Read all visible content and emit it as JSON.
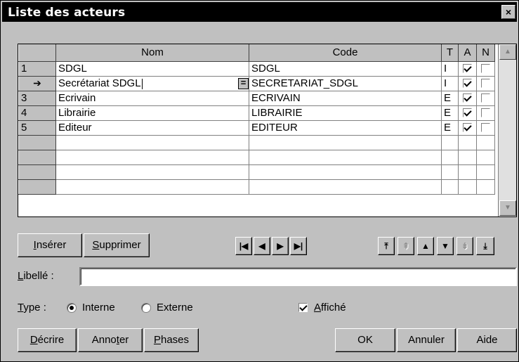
{
  "window": {
    "title": "Liste des acteurs",
    "close_label": "×"
  },
  "grid": {
    "columns": {
      "nom": "Nom",
      "code": "Code",
      "t": "T",
      "a": "A",
      "n": "N"
    },
    "rows": [
      {
        "marker": "1",
        "nom": "SDGL",
        "code": "SDGL",
        "t": "I",
        "a": true,
        "n": false
      },
      {
        "marker": "➔",
        "nom": "Secrétariat SDGL",
        "code": "SECRETARIAT_SDGL",
        "t": "I",
        "a": true,
        "n": false,
        "edit_button": "="
      },
      {
        "marker": "3",
        "nom": "Ecrivain",
        "code": "ECRIVAIN",
        "t": "E",
        "a": true,
        "n": false
      },
      {
        "marker": "4",
        "nom": "Librairie",
        "code": "LIBRAIRIE",
        "t": "E",
        "a": true,
        "n": false
      },
      {
        "marker": "5",
        "nom": "Editeur",
        "code": "EDITEUR",
        "t": "E",
        "a": true,
        "n": false
      }
    ]
  },
  "buttons": {
    "inserer": {
      "hot": "I",
      "rest": "nsérer"
    },
    "supprimer": {
      "hot": "S",
      "rest": "upprimer"
    },
    "decrire": {
      "hot": "D",
      "rest": "écrire"
    },
    "annoter": {
      "pre": "Anno",
      "hot": "t",
      "rest": "er"
    },
    "phases": {
      "hot": "P",
      "rest": "hases"
    },
    "ok": "OK",
    "annuler": "Annuler",
    "aide": "Aide"
  },
  "navigation": {
    "first": "|◀",
    "prev": "◀",
    "next": "▶",
    "last": "▶|"
  },
  "move": {
    "top": "⤒",
    "up_disabled": "⇞",
    "up": "▲",
    "down": "▼",
    "down_disabled": "⇟",
    "bottom": "⤓"
  },
  "libelle": {
    "hot": "L",
    "rest": "ibellé :",
    "value": ""
  },
  "type": {
    "label_hot": "T",
    "label_rest": "ype :",
    "options": [
      "Interne",
      "Externe"
    ],
    "selected": "Interne"
  },
  "affiche": {
    "hot": "A",
    "rest": "ffiché",
    "checked": true
  }
}
